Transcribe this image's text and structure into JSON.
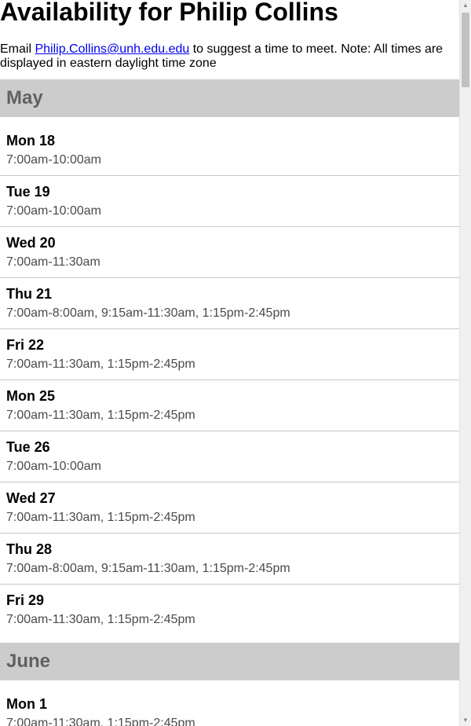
{
  "page": {
    "title": "Availability for Philip Collins",
    "intro": {
      "prefix": "Email ",
      "email": "Philip.Collins@unh.edu.edu",
      "suffix": " to suggest a time to meet. Note: All times are displayed in eastern daylight time zone"
    }
  },
  "schedule": [
    {
      "month": "May",
      "days": [
        {
          "label": "Mon 18",
          "times": "7:00am-10:00am"
        },
        {
          "label": "Tue 19",
          "times": "7:00am-10:00am"
        },
        {
          "label": "Wed 20",
          "times": "7:00am-11:30am"
        },
        {
          "label": "Thu 21",
          "times": "7:00am-8:00am, 9:15am-11:30am, 1:15pm-2:45pm"
        },
        {
          "label": "Fri 22",
          "times": "7:00am-11:30am, 1:15pm-2:45pm"
        },
        {
          "label": "Mon 25",
          "times": "7:00am-11:30am, 1:15pm-2:45pm"
        },
        {
          "label": "Tue 26",
          "times": "7:00am-10:00am"
        },
        {
          "label": "Wed 27",
          "times": "7:00am-11:30am, 1:15pm-2:45pm"
        },
        {
          "label": "Thu 28",
          "times": "7:00am-8:00am, 9:15am-11:30am, 1:15pm-2:45pm"
        },
        {
          "label": "Fri 29",
          "times": "7:00am-11:30am, 1:15pm-2:45pm"
        }
      ]
    },
    {
      "month": "June",
      "days": [
        {
          "label": "Mon 1",
          "times": "7:00am-11:30am, 1:15pm-2:45pm"
        }
      ]
    }
  ],
  "scrollbar": {
    "up_icon": "triangle-up-icon",
    "down_icon": "triangle-down-icon"
  }
}
